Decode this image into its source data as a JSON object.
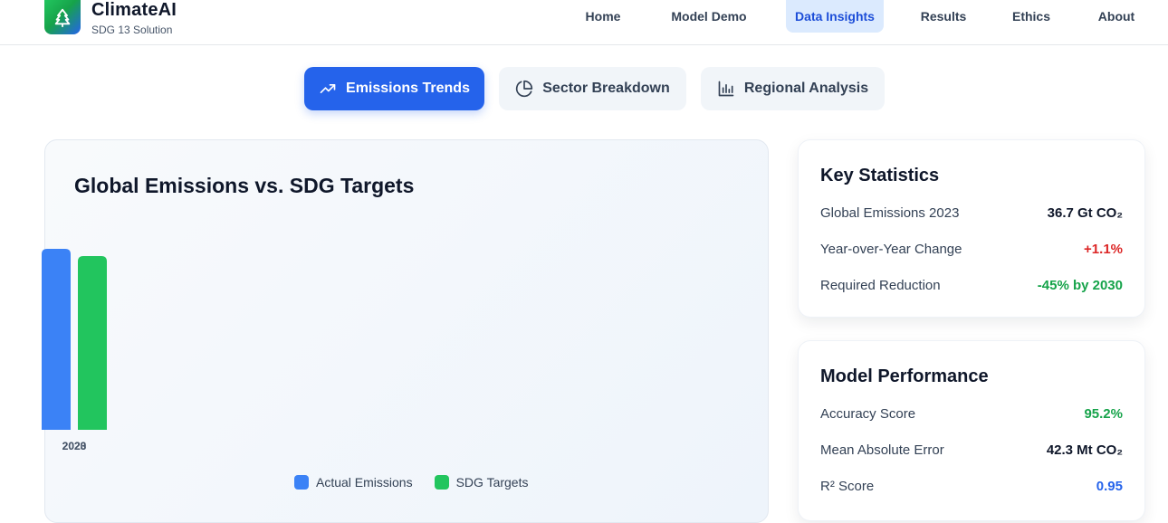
{
  "brand": {
    "name": "ClimateAI",
    "subtitle": "SDG 13 Solution"
  },
  "nav": [
    {
      "label": "Home",
      "active": false
    },
    {
      "label": "Model Demo",
      "active": false
    },
    {
      "label": "Data Insights",
      "active": true
    },
    {
      "label": "Results",
      "active": false
    },
    {
      "label": "Ethics",
      "active": false
    },
    {
      "label": "About",
      "active": false
    }
  ],
  "tabs": [
    {
      "label": "Emissions Trends",
      "icon": "trending-up-icon",
      "active": true
    },
    {
      "label": "Sector Breakdown",
      "icon": "pie-chart-icon",
      "active": false
    },
    {
      "label": "Regional Analysis",
      "icon": "bar-chart-icon",
      "active": false
    }
  ],
  "chart": {
    "title": "Global Emissions vs. SDG Targets",
    "legend": [
      {
        "label": "Actual Emissions",
        "color": "#3b82f6"
      },
      {
        "label": "SDG Targets",
        "color": "#22c55e"
      }
    ]
  },
  "chart_data": {
    "type": "bar",
    "title": "Global Emissions vs. SDG Targets",
    "categories": [
      "2020"
    ],
    "overlapping_tick_label": "2023",
    "series": [
      {
        "name": "Actual Emissions",
        "color": "#3b82f6",
        "values": [
          100
        ]
      },
      {
        "name": "SDG Targets",
        "color": "#22c55e",
        "values": [
          96
        ]
      }
    ],
    "legend_position": "bottom"
  },
  "key_stats": {
    "title": "Key Statistics",
    "rows": [
      {
        "label": "Global Emissions 2023",
        "value": "36.7 Gt CO₂",
        "color": "#0f172a"
      },
      {
        "label": "Year-over-Year Change",
        "value": "+1.1%",
        "color": "#dc2626"
      },
      {
        "label": "Required Reduction",
        "value": "-45% by 2030",
        "color": "#16a34a"
      }
    ]
  },
  "model_perf": {
    "title": "Model Performance",
    "rows": [
      {
        "label": "Accuracy Score",
        "value": "95.2%",
        "color": "#16a34a"
      },
      {
        "label": "Mean Absolute Error",
        "value": "42.3 Mt CO₂",
        "color": "#0f172a"
      },
      {
        "label": "R² Score",
        "value": "0.95",
        "color": "#2563eb"
      }
    ]
  }
}
